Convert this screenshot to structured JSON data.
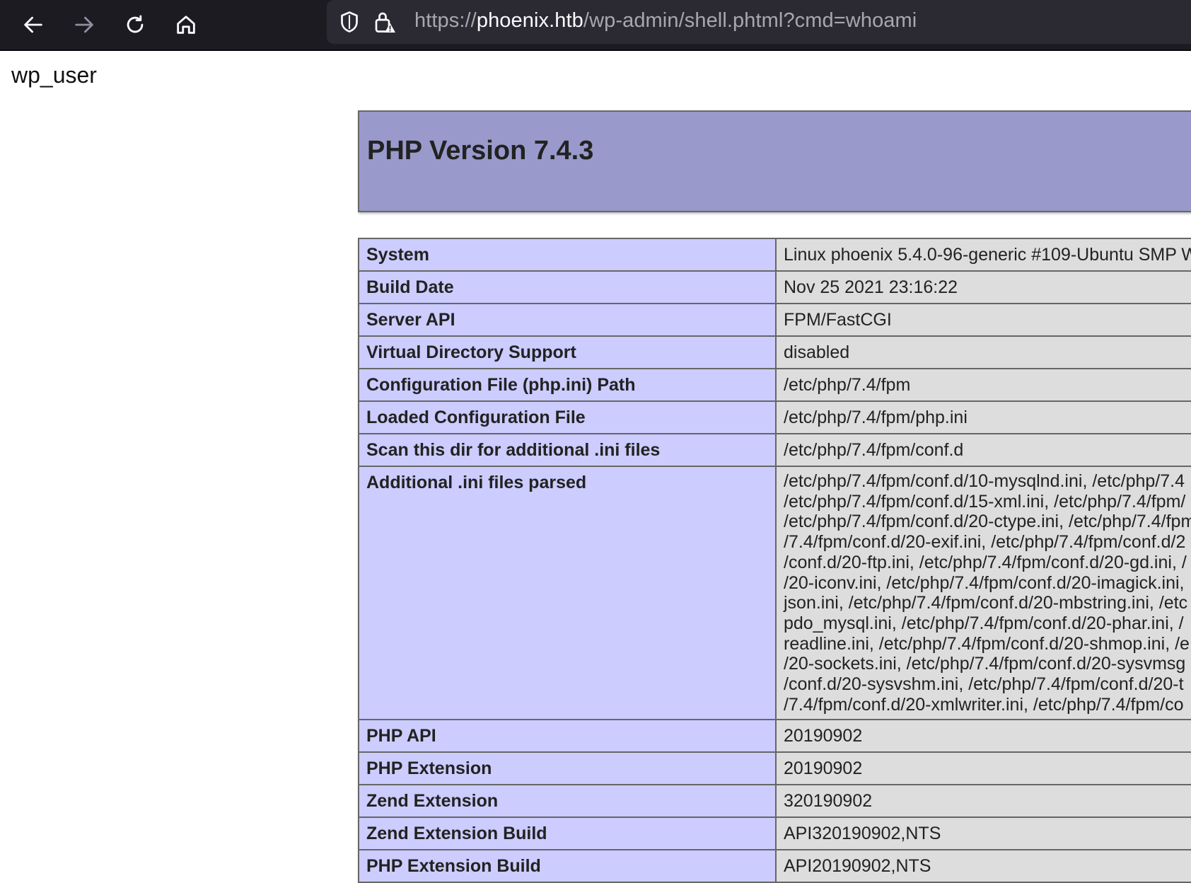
{
  "browser": {
    "url_scheme": "https://",
    "url_host": "phoenix.htb",
    "url_path": "/wp-admin/shell.phtml?cmd=whoami"
  },
  "page": {
    "command_output": "wp_user",
    "php_version_title": "PHP Version 7.4.3",
    "rows": [
      {
        "key": "System",
        "value": "Linux phoenix 5.4.0-96-generic #109-Ubuntu SMP W"
      },
      {
        "key": "Build Date",
        "value": "Nov 25 2021 23:16:22"
      },
      {
        "key": "Server API",
        "value": "FPM/FastCGI"
      },
      {
        "key": "Virtual Directory Support",
        "value": "disabled"
      },
      {
        "key": "Configuration File (php.ini) Path",
        "value": "/etc/php/7.4/fpm"
      },
      {
        "key": "Loaded Configuration File",
        "value": "/etc/php/7.4/fpm/php.ini"
      },
      {
        "key": "Scan this dir for additional .ini files",
        "value": "/etc/php/7.4/fpm/conf.d"
      },
      {
        "key": "Additional .ini files parsed",
        "lines": [
          "/etc/php/7.4/fpm/conf.d/10-mysqlnd.ini, /etc/php/7.4",
          "/etc/php/7.4/fpm/conf.d/15-xml.ini, /etc/php/7.4/fpm/",
          "/etc/php/7.4/fpm/conf.d/20-ctype.ini, /etc/php/7.4/fpm",
          "/7.4/fpm/conf.d/20-exif.ini, /etc/php/7.4/fpm/conf.d/2",
          "/conf.d/20-ftp.ini, /etc/php/7.4/fpm/conf.d/20-gd.ini, /",
          "/20-iconv.ini, /etc/php/7.4/fpm/conf.d/20-imagick.ini,",
          "json.ini, /etc/php/7.4/fpm/conf.d/20-mbstring.ini, /etc",
          "pdo_mysql.ini, /etc/php/7.4/fpm/conf.d/20-phar.ini, /",
          "readline.ini, /etc/php/7.4/fpm/conf.d/20-shmop.ini, /e",
          "/20-sockets.ini, /etc/php/7.4/fpm/conf.d/20-sysvmsg",
          "/conf.d/20-sysvshm.ini, /etc/php/7.4/fpm/conf.d/20-t",
          "/7.4/fpm/conf.d/20-xmlwriter.ini, /etc/php/7.4/fpm/co"
        ]
      },
      {
        "key": "PHP API",
        "value": "20190902"
      },
      {
        "key": "PHP Extension",
        "value": "20190902"
      },
      {
        "key": "Zend Extension",
        "value": "320190902"
      },
      {
        "key": "Zend Extension Build",
        "value": "API320190902,NTS"
      },
      {
        "key": "PHP Extension Build",
        "value": "API20190902,NTS"
      }
    ]
  }
}
